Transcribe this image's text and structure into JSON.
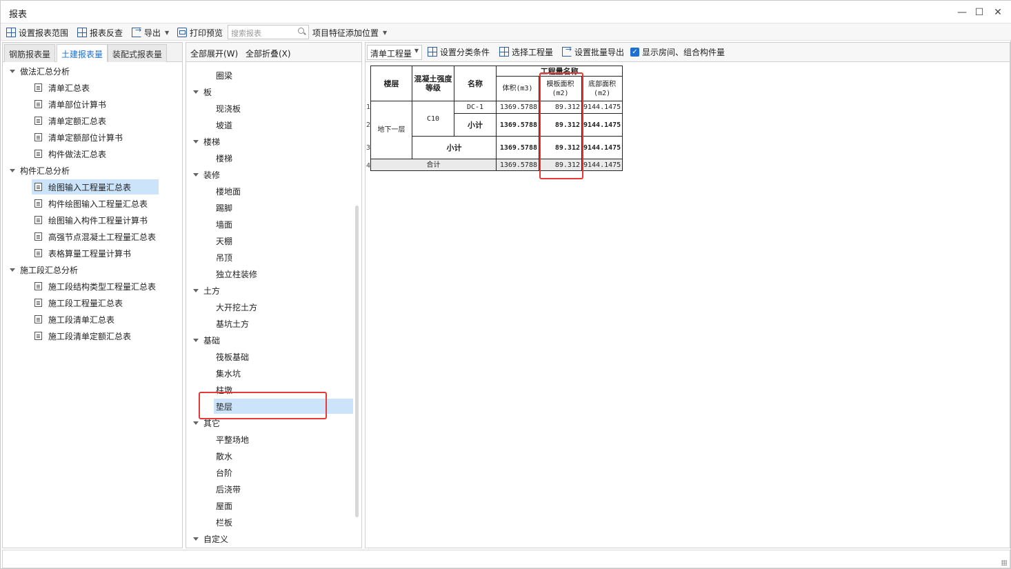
{
  "window": {
    "title": "报表"
  },
  "toolbar": {
    "set_range": "设置报表范围",
    "reverse_check": "报表反查",
    "export": "导出",
    "print_preview": "打印预览",
    "search_placeholder": "搜索报表",
    "feature_position": "项目特征添加位置"
  },
  "left_tabs": [
    "钢筋报表量",
    "土建报表量",
    "装配式报表量"
  ],
  "left_tree": [
    {
      "label": "做法汇总分析",
      "level": 0
    },
    {
      "label": "清单汇总表",
      "level": 1
    },
    {
      "label": "清单部位计算书",
      "level": 1
    },
    {
      "label": "清单定额汇总表",
      "level": 1
    },
    {
      "label": "清单定额部位计算书",
      "level": 1
    },
    {
      "label": "构件做法汇总表",
      "level": 1
    },
    {
      "label": "构件汇总分析",
      "level": 0
    },
    {
      "label": "绘图输入工程量汇总表",
      "level": 1
    },
    {
      "label": "构件绘图输入工程量汇总表",
      "level": 1
    },
    {
      "label": "绘图输入构件工程量计算书",
      "level": 1
    },
    {
      "label": "高强节点混凝土工程量汇总表",
      "level": 1
    },
    {
      "label": "表格算量工程量计算书",
      "level": 1
    },
    {
      "label": "施工段汇总分析",
      "level": 0
    },
    {
      "label": "施工段结构类型工程量汇总表",
      "level": 1
    },
    {
      "label": "施工段工程量汇总表",
      "level": 1
    },
    {
      "label": "施工段清单汇总表",
      "level": 1
    },
    {
      "label": "施工段清单定额汇总表",
      "level": 1
    }
  ],
  "mid_header": {
    "expand_all": "全部展开(W)",
    "collapse_all": "全部折叠(X)"
  },
  "mid_tree": [
    {
      "label": "圈梁",
      "level": 1
    },
    {
      "label": "板",
      "level": 0
    },
    {
      "label": "现浇板",
      "level": 1
    },
    {
      "label": "坡道",
      "level": 1
    },
    {
      "label": "楼梯",
      "level": 0
    },
    {
      "label": "楼梯",
      "level": 1
    },
    {
      "label": "装修",
      "level": 0
    },
    {
      "label": "楼地面",
      "level": 1
    },
    {
      "label": "踢脚",
      "level": 1
    },
    {
      "label": "墙面",
      "level": 1
    },
    {
      "label": "天棚",
      "level": 1
    },
    {
      "label": "吊顶",
      "level": 1
    },
    {
      "label": "独立柱装修",
      "level": 1
    },
    {
      "label": "土方",
      "level": 0
    },
    {
      "label": "大开挖土方",
      "level": 1
    },
    {
      "label": "基坑土方",
      "level": 1
    },
    {
      "label": "基础",
      "level": 0
    },
    {
      "label": "筏板基础",
      "level": 1
    },
    {
      "label": "集水坑",
      "level": 1
    },
    {
      "label": "柱墩",
      "level": 1
    },
    {
      "label": "垫层",
      "level": 1
    },
    {
      "label": "其它",
      "level": 0
    },
    {
      "label": "平整场地",
      "level": 1
    },
    {
      "label": "散水",
      "level": 1
    },
    {
      "label": "台阶",
      "level": 1
    },
    {
      "label": "后浇带",
      "level": 1
    },
    {
      "label": "屋面",
      "level": 1
    },
    {
      "label": "栏板",
      "level": 1
    },
    {
      "label": "自定义",
      "level": 0
    }
  ],
  "right_toolbar": {
    "combo_value": "清单工程量",
    "set_category": "设置分类条件",
    "select_quantity": "选择工程量",
    "batch_export": "设置批量导出",
    "show_rooms": "显示房间、组合构件量"
  },
  "report": {
    "headers": {
      "floor": "楼层",
      "concrete_grade": "混凝土强度等级",
      "name": "名称",
      "quantity_group": "工程量名称",
      "volume": "体积(m3)",
      "formwork_area": "模板面积(m2)",
      "bottom_area": "底部面积(m2)"
    },
    "row_numbers": [
      "1",
      "2",
      "3",
      "4"
    ],
    "floor_value": "地下一层",
    "grade_value": "C10",
    "rows": {
      "r1": {
        "name": "DC-1",
        "volume": "1369.5788",
        "formwork": "89.312",
        "bottom": "9144.1475"
      },
      "r2": {
        "name": "小计",
        "volume": "1369.5788",
        "formwork": "89.312",
        "bottom": "9144.1475"
      },
      "r3": {
        "name": "小计",
        "volume": "1369.5788",
        "formwork": "89.312",
        "bottom": "9144.1475"
      },
      "r4": {
        "name": "合计",
        "volume": "1369.5788",
        "formwork": "89.312",
        "bottom": "9144.1475"
      }
    }
  },
  "colors": {
    "accent": "#1e6fd0",
    "selection": "#cce4fa",
    "highlight": "#e53935"
  }
}
